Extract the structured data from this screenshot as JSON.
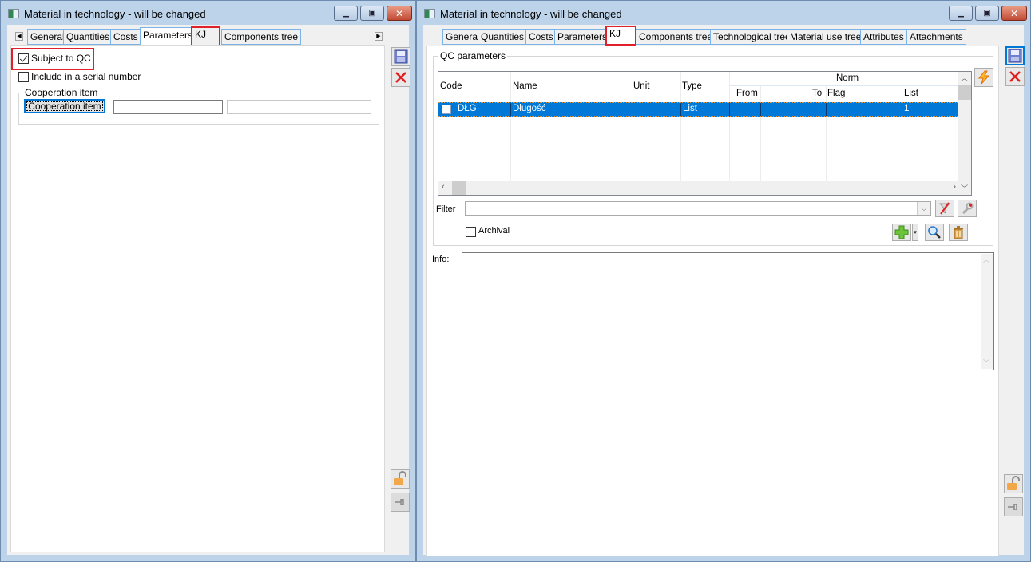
{
  "left_window": {
    "title": "Material in technology - will be changed",
    "tabs": [
      {
        "label": "General"
      },
      {
        "label": "Quantities"
      },
      {
        "label": "Costs"
      },
      {
        "label": "Parameters",
        "active": true
      },
      {
        "label": "KJ",
        "highlighted": true
      },
      {
        "label": "Components tree"
      }
    ],
    "checkboxes": [
      {
        "label": "Subject to QC",
        "checked": true,
        "highlighted": true
      },
      {
        "label": "Include in a serial number",
        "checked": false
      }
    ],
    "cooperation_group": {
      "title": "Cooperation item",
      "button_label": "Cooperation item",
      "code_value": "",
      "name_value": ""
    }
  },
  "right_window": {
    "title": "Material in technology - will be changed",
    "tabs": [
      {
        "label": "General"
      },
      {
        "label": "Quantities"
      },
      {
        "label": "Costs"
      },
      {
        "label": "Parameters"
      },
      {
        "label": "KJ",
        "active": true,
        "highlighted": true
      },
      {
        "label": "Components tree"
      },
      {
        "label": "Technological tree"
      },
      {
        "label": "Material use tree"
      },
      {
        "label": "Attributes"
      },
      {
        "label": "Attachments"
      }
    ],
    "qc_group_title": "QC parameters",
    "grid": {
      "columns": {
        "code": "Code",
        "name": "Name",
        "unit": "Unit",
        "type": "Type",
        "norm": "Norm",
        "from": "From",
        "to": "To",
        "flag": "Flag",
        "list": "List"
      },
      "rows": [
        {
          "checked": false,
          "code": "DŁG",
          "name": "Długość",
          "unit": "",
          "type": "List",
          "from": "",
          "to": "",
          "flag": "",
          "list": "1",
          "selected": true
        }
      ]
    },
    "filter": {
      "label": "Filter",
      "value": ""
    },
    "archival": {
      "label": "Archival",
      "checked": false
    },
    "info": {
      "label": "Info:",
      "value": ""
    }
  },
  "colors": {
    "selection": "#0078d7",
    "highlight_box": "#e0202a",
    "tab_border": "#7ab3e8",
    "window_frame": "#bcd3ea"
  }
}
